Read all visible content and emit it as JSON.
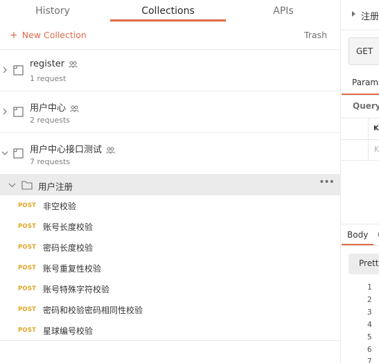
{
  "sidebar": {
    "tabs": [
      {
        "label": "History"
      },
      {
        "label": "Collections"
      },
      {
        "label": "APIs"
      }
    ],
    "new_collection": "New Collection",
    "trash": "Trash",
    "collections": [
      {
        "name": "register",
        "count": "1 request"
      },
      {
        "name": "用户中心",
        "count": "2 requests"
      },
      {
        "name": "用户中心接口测试",
        "count": "7 requests"
      }
    ],
    "folder": {
      "name": "用户注册",
      "more": "•••"
    },
    "requests": [
      {
        "method": "POST",
        "name": "非空校验"
      },
      {
        "method": "POST",
        "name": "账号长度校验"
      },
      {
        "method": "POST",
        "name": "密码长度校验"
      },
      {
        "method": "POST",
        "name": "账号重复性校验"
      },
      {
        "method": "POST",
        "name": "账号特殊字符校验"
      },
      {
        "method": "POST",
        "name": "密码和校验密码相同性校验"
      },
      {
        "method": "POST",
        "name": "星球编号校验"
      }
    ]
  },
  "request_panel": {
    "title": "注册",
    "method": "GET",
    "params_tab": "Params",
    "query_label": "Query",
    "key_header": "KE",
    "key_placeholder": "K"
  },
  "response_panel": {
    "body_tab": "Body",
    "next_tab": "C",
    "pretty_button": "Pretty",
    "line_numbers": [
      "1",
      "2",
      "3",
      "4",
      "5",
      "6",
      "7"
    ]
  },
  "colors": {
    "accent": "#e06a4a",
    "post": "#e0a526",
    "selected_row": "#ebebeb"
  }
}
